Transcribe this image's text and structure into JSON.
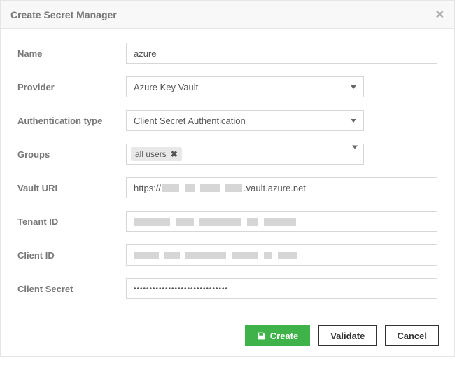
{
  "header": {
    "title": "Create Secret Manager"
  },
  "labels": {
    "name": "Name",
    "provider": "Provider",
    "auth_type": "Authentication type",
    "groups": "Groups",
    "vault_uri": "Vault URI",
    "tenant_id": "Tenant ID",
    "client_id": "Client ID",
    "client_secret": "Client Secret"
  },
  "values": {
    "name": "azure",
    "provider_selected": "Azure Key Vault",
    "auth_type_selected": "Client Secret Authentication",
    "groups_tag": "all users",
    "vault_uri_prefix": "https://",
    "vault_uri_suffix": ".vault.azure.net",
    "client_secret": "••••••••••••••••••••••••••••••"
  },
  "buttons": {
    "create": "Create",
    "validate": "Validate",
    "cancel": "Cancel"
  }
}
